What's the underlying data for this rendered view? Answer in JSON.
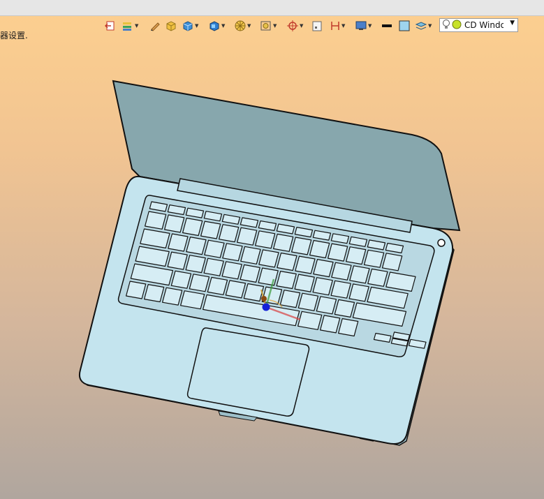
{
  "status": {
    "message": "器设置."
  },
  "toolbar": {
    "icons": [
      "exit-icon",
      "layer-filter-icon",
      "pencil-icon",
      "box-render-icon",
      "box-shaded-icon",
      "view-cube-icon",
      "wheel-icon",
      "view-fit-icon",
      "snap-target-icon",
      "blank-page-icon",
      "measure-icon",
      "screen-icon",
      "color-black-swatch",
      "color-blue-swatch",
      "layers-icon"
    ]
  },
  "scene_select": {
    "selected": "CD Window"
  },
  "colors": {
    "background_top": "#fdd08f",
    "background_bottom": "#b0a69e",
    "laptop_body": "#c4e4ee",
    "laptop_screen": "#87a7ad",
    "origin_dot": "#1422d8"
  }
}
